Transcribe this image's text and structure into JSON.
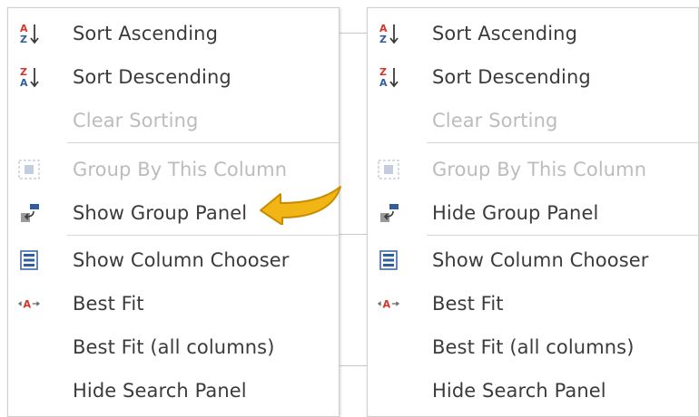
{
  "menus": [
    {
      "id": "left",
      "items": [
        {
          "label": "Sort Ascending",
          "icon": "sort-ascending-icon",
          "enabled": true
        },
        {
          "label": "Sort Descending",
          "icon": "sort-descending-icon",
          "enabled": true
        },
        {
          "label": "Clear Sorting",
          "icon": "",
          "enabled": false
        },
        {
          "label": "Group By This Column",
          "icon": "group-by-column-icon",
          "enabled": false
        },
        {
          "label": "Show Group Panel",
          "icon": "group-panel-icon",
          "enabled": true
        },
        {
          "label": "Show Column Chooser",
          "icon": "column-chooser-icon",
          "enabled": true
        },
        {
          "label": "Best Fit",
          "icon": "best-fit-icon",
          "enabled": true
        },
        {
          "label": "Best Fit (all columns)",
          "icon": "",
          "enabled": true
        },
        {
          "label": "Hide Search Panel",
          "icon": "",
          "enabled": true
        }
      ]
    },
    {
      "id": "right",
      "items": [
        {
          "label": "Sort Ascending",
          "icon": "sort-ascending-icon",
          "enabled": true
        },
        {
          "label": "Sort Descending",
          "icon": "sort-descending-icon",
          "enabled": true
        },
        {
          "label": "Clear Sorting",
          "icon": "",
          "enabled": false
        },
        {
          "label": "Group By This Column",
          "icon": "group-by-column-icon",
          "enabled": false
        },
        {
          "label": "Hide Group Panel",
          "icon": "group-panel-icon",
          "enabled": true
        },
        {
          "label": "Show Column Chooser",
          "icon": "column-chooser-icon",
          "enabled": true
        },
        {
          "label": "Best Fit",
          "icon": "best-fit-icon",
          "enabled": true
        },
        {
          "label": "Best Fit (all columns)",
          "icon": "",
          "enabled": true
        },
        {
          "label": "Hide Search Panel",
          "icon": "",
          "enabled": true
        }
      ]
    }
  ],
  "annotation": {
    "arrow_color": "#f2b516",
    "arrow_outline": "#c98b00"
  },
  "colors": {
    "icon_red": "#d9342b",
    "icon_blue": "#2f5f9e",
    "icon_gray": "#6b6b6b",
    "disabled_text": "#bcbcbc"
  }
}
